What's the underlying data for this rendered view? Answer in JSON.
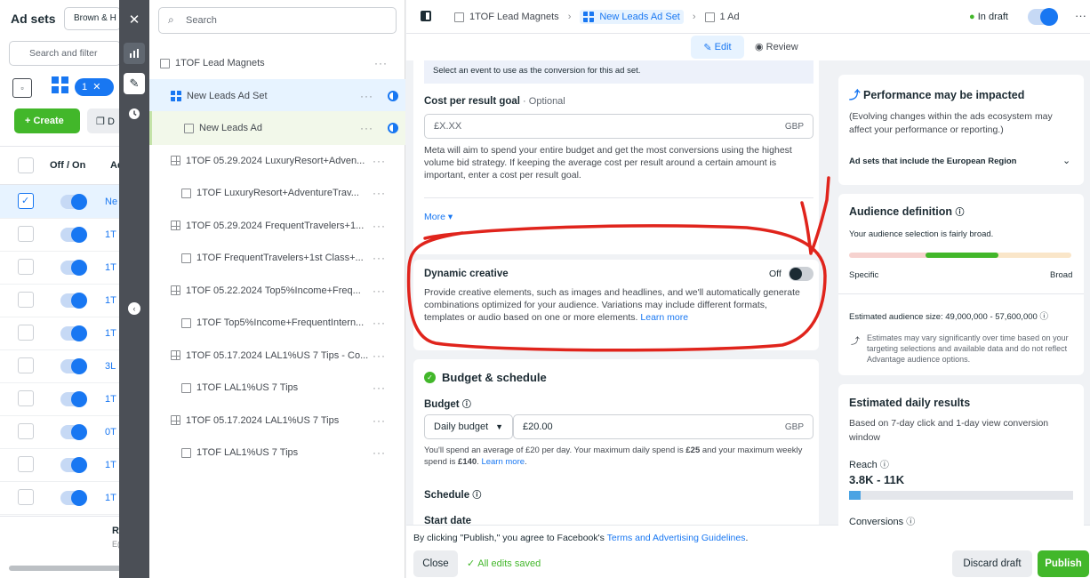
{
  "left_panel": {
    "title": "Ad sets",
    "account_select": "Brown & H",
    "search_placeholder": "Search and filter",
    "selected_badge": "1",
    "create_label": "+ Create",
    "dup_label": "D",
    "col_off_on": "Off / On",
    "col_ad": "Ad",
    "rows": [
      {
        "name": "Ne",
        "checked": true
      },
      {
        "name": "1T"
      },
      {
        "name": "1T"
      },
      {
        "name": "1T"
      },
      {
        "name": "1T"
      },
      {
        "name": "3L"
      },
      {
        "name": "1T"
      },
      {
        "name": "0T"
      },
      {
        "name": "1T"
      },
      {
        "name": "1T"
      }
    ],
    "footer_r": "R",
    "footer_e": "E("
  },
  "tree": {
    "search_placeholder": "Search",
    "items": [
      {
        "label": "1TOF Lead Magnets",
        "level": 0,
        "icon": "folder-icon"
      },
      {
        "label": "New Leads Ad Set",
        "level": 1,
        "icon": "adset-blue-icon",
        "selected": true
      },
      {
        "label": "New Leads Ad",
        "level": 2,
        "icon": "ad-icon",
        "selected": true
      },
      {
        "label": "1TOF 05.29.2024 LuxuryResort+Adven...",
        "level": 1,
        "icon": "adset-icon"
      },
      {
        "label": "1TOF LuxuryResort+AdventureTrav...",
        "level": 2,
        "icon": "ad-icon"
      },
      {
        "label": "1TOF 05.29.2024 FrequentTravelers+1...",
        "level": 1,
        "icon": "adset-icon"
      },
      {
        "label": "1TOF FrequentTravelers+1st Class+...",
        "level": 2,
        "icon": "ad-icon"
      },
      {
        "label": "1TOF 05.22.2024 Top5%Income+Freq...",
        "level": 1,
        "icon": "adset-icon"
      },
      {
        "label": "1TOF Top5%Income+FrequentIntern...",
        "level": 2,
        "icon": "ad-icon"
      },
      {
        "label": "1TOF 05.17.2024 LAL1%US 7 Tips - Co...",
        "level": 1,
        "icon": "adset-icon"
      },
      {
        "label": "1TOF LAL1%US 7 Tips",
        "level": 2,
        "icon": "ad-icon"
      },
      {
        "label": "1TOF 05.17.2024 LAL1%US 7 Tips",
        "level": 1,
        "icon": "adset-icon"
      },
      {
        "label": "1TOF LAL1%US 7 Tips",
        "level": 2,
        "icon": "ad-icon"
      }
    ],
    "dots": "···"
  },
  "header": {
    "crumb1": "1TOF Lead Magnets",
    "crumb2": "New Leads Ad Set",
    "crumb3": "1 Ad",
    "status": "In draft",
    "edit_label": "Edit",
    "review_label": "Review",
    "more": "···"
  },
  "main": {
    "conversion_note": "Select an event to use as the conversion for this ad set.",
    "cost_goal_label": "Cost per result goal",
    "cost_goal_optional": " · Optional",
    "cost_placeholder": "£X.XX",
    "currency": "GBP",
    "cost_desc": "Meta will aim to spend your entire budget and get the most conversions using the highest volume bid strategy. If keeping the average cost per result around a certain amount is important, enter a cost per result goal.",
    "more_label": "More ▾",
    "dynamic_title": "Dynamic creative",
    "dynamic_state": "Off",
    "dynamic_desc": "Provide creative elements, such as images and headlines, and we'll automatically generate combinations optimized for your audience. Variations may include different formats, templates or audio based on one or more elements.",
    "learn_more": "Learn more",
    "budget_title": "Budget & schedule",
    "budget_label": "Budget",
    "budget_type": "Daily budget",
    "budget_value": "£20.00",
    "budget_note_1": "You'll spend an average of £20 per day. Your maximum daily spend is ",
    "budget_note_max": "£25",
    "budget_note_2": " and your maximum weekly spend is ",
    "budget_note_week": "£140",
    "budget_note_3": ". ",
    "schedule_label": "Schedule",
    "start_date_label": "Start date",
    "terms_pre": "By clicking \"Publish,\" you agree to Facebook's ",
    "terms_link": "Terms and Advertising Guidelines",
    "terms_post": ".",
    "close_label": "Close",
    "saved_label": "All edits saved",
    "discard_label": "Discard draft",
    "publish_label": "Publish"
  },
  "right": {
    "perf_title": "Performance may be impacted",
    "perf_desc": "(Evolving changes within the ads ecosystem may affect your performance or reporting.)",
    "perf_expander": "Ad sets that include the European Region",
    "aud_title": "Audience definition",
    "aud_desc": "Your audience selection is fairly broad.",
    "aud_specific": "Specific",
    "aud_broad": "Broad",
    "aud_size": "Estimated audience size: 49,000,000 - 57,600,000",
    "aud_note": "Estimates may vary significantly over time based on your targeting selections and available data and do not reflect Advantage audience options.",
    "daily_title": "Estimated daily results",
    "daily_desc": "Based on 7-day click and 1-day view conversion window",
    "reach_label": "Reach",
    "reach_value": "3.8K - 11K",
    "reach_fill": 0.05,
    "conversions_label": "Conversions"
  },
  "colors": {
    "brand_blue": "#1877f2",
    "green": "#42b72a",
    "annotation_red": "#e0241c"
  }
}
